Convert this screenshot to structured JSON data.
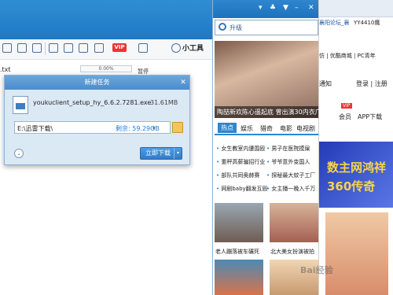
{
  "download_manager": {
    "tools_label": "小工具",
    "file_name": ".txt",
    "progress_text": "0.00%",
    "pause_text": "暂停",
    "vip_badge": "VIP",
    "toolbar_icons": [
      "list-icon",
      "magnet-icon",
      "trash-icon",
      "search-icon",
      "grid-icon",
      "sort-icon",
      "folder-icon",
      "refresh-icon",
      "bolt-icon",
      "share-icon"
    ]
  },
  "dialog": {
    "title": "新建任务",
    "close_icon": "close-icon",
    "file_name": "youkuclient_setup_hy_6.6.2.7281.exe",
    "file_size": "31.61MB",
    "path": "E:\\迅雷下载\\",
    "remaining": "剩余: 59.29GB",
    "download_button": "立即下载",
    "dropdown_arrow": "▾"
  },
  "mini_panel": {
    "search_placeholder": "升级",
    "hero_caption": "陶喆新欢陈心遥起底 曾出演30内衣广告",
    "tabs": [
      "热点",
      "娱乐",
      "猎奇",
      "电影",
      "电视剧"
    ],
    "news_left": [
      "女生教室内遭围殴",
      "重秤高薪骗招行业",
      "部队共同奥赫赛",
      "网剧baby翻发互殴"
    ],
    "news_right": [
      "男子在医院摸屎",
      "爷爷意外变国人",
      "探秘最大蚊子工厂",
      "女主播一晚入千万"
    ],
    "thumb_captions": [
      "老人蹦落被车碾死",
      "北大美女扮演被拍"
    ]
  },
  "browser_strip": {
    "tab_xy": "襄阳论坛_襄",
    "tab_yy": "YY4410鹰",
    "nav_items": "仿 | 优酷商城 | PC青年",
    "nav_left": "通知",
    "login": "登录 | 注册",
    "vip": "VIP",
    "member": "会员",
    "app_download": "APP下载",
    "ad_line1": "数主网鸿祥",
    "ad_line2": "360传奇"
  },
  "watermark": "Bai经验"
}
